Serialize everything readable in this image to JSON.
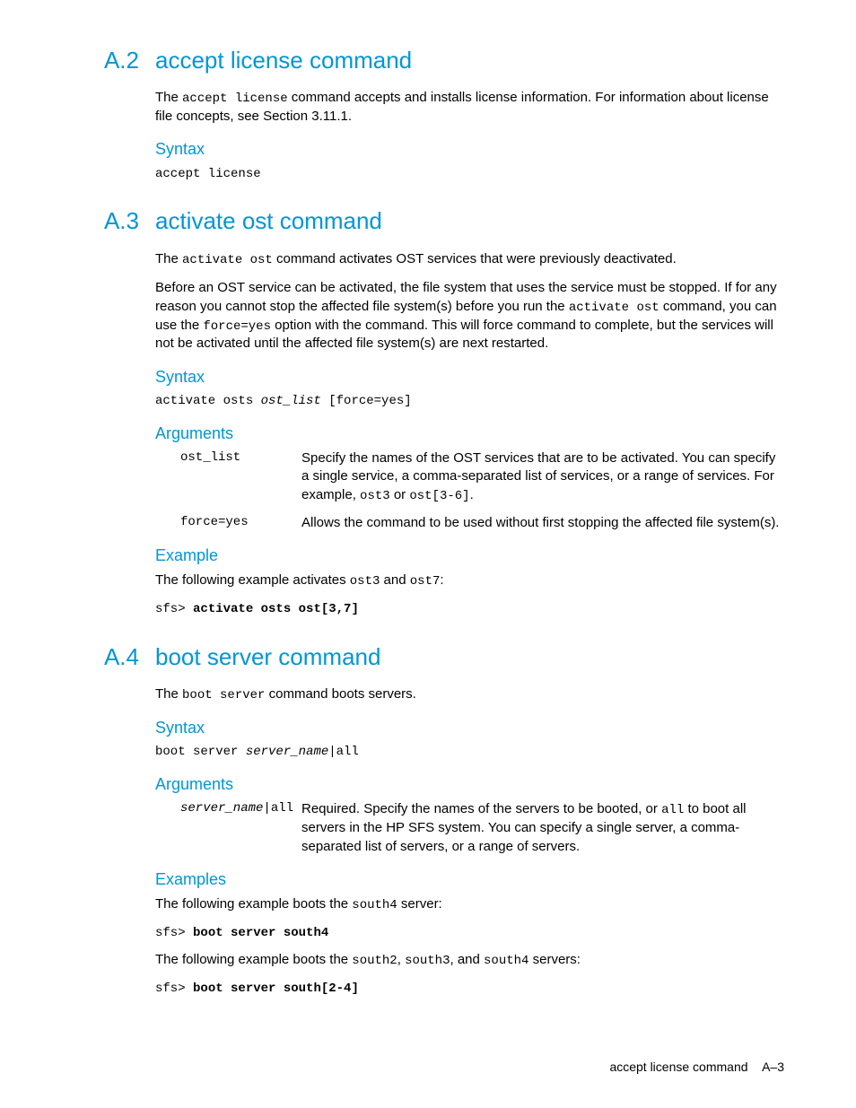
{
  "sections": [
    {
      "number": "A.2",
      "title": "accept license command",
      "intro_pre": "The ",
      "intro_code": "accept license",
      "intro_post": " command accepts and installs license information. For information about license file concepts, see Section 3.11.1.",
      "syntax_label": "Syntax",
      "syntax_code": "accept license"
    },
    {
      "number": "A.3",
      "title": "activate ost command",
      "intro_pre": "The ",
      "intro_code": "activate ost",
      "intro_post": " command activates OST services that were previously deactivated.",
      "para2_a": "Before an OST service can be activated, the file system that uses the service must be stopped. If for any reason you cannot stop the affected file system(s) before you run the ",
      "para2_code1": "activate ost",
      "para2_b": " command, you can use the ",
      "para2_code2": "force=yes",
      "para2_c": " option with the command. This will force command to complete, but the services will not be activated until the affected file system(s) are next restarted.",
      "syntax_label": "Syntax",
      "syntax_line_a": "activate osts ",
      "syntax_line_italic": "ost_list",
      "syntax_line_b": " [force=yes]",
      "arguments_label": "Arguments",
      "arg1_name": "ost_list",
      "arg1_desc_a": "Specify the names of the OST services that are to be activated. You can specify a single service, a comma-separated list of services, or a range of services. For example, ",
      "arg1_desc_code1": "ost3",
      "arg1_desc_b": " or ",
      "arg1_desc_code2": "ost[3-6]",
      "arg1_desc_c": ".",
      "arg2_name": "force=yes",
      "arg2_desc": "Allows the command to be used without first stopping the affected file system(s).",
      "example_label": "Example",
      "example_intro_a": "The following example activates ",
      "example_intro_code1": "ost3",
      "example_intro_b": " and ",
      "example_intro_code2": "ost7",
      "example_intro_c": ":",
      "example_prompt": "sfs> ",
      "example_cmd": "activate osts ost[3,7]"
    },
    {
      "number": "A.4",
      "title": "boot server command",
      "intro_pre": "The ",
      "intro_code": "boot server",
      "intro_post": " command boots servers.",
      "syntax_label": "Syntax",
      "syntax_line_a": "boot server ",
      "syntax_line_italic": "server_name",
      "syntax_line_b": "|all",
      "arguments_label": "Arguments",
      "arg1_name_italic": "server_name",
      "arg1_name_plain": "|all",
      "arg1_desc_a": "Required. Specify the names of the servers to be booted, or ",
      "arg1_desc_code1": "all",
      "arg1_desc_b": " to boot all servers in the HP SFS system. You can specify a single server, a comma-separated list of servers, or a range of servers.",
      "examples_label": "Examples",
      "ex1_intro_a": "The following example boots the ",
      "ex1_intro_code": "south4",
      "ex1_intro_b": " server:",
      "ex1_prompt": "sfs> ",
      "ex1_cmd": "boot server south4",
      "ex2_intro_a": "The following example boots the ",
      "ex2_intro_code1": "south2",
      "ex2_intro_b": ", ",
      "ex2_intro_code2": "south3",
      "ex2_intro_c": ", and ",
      "ex2_intro_code3": "south4",
      "ex2_intro_d": " servers:",
      "ex2_prompt": "sfs> ",
      "ex2_cmd": "boot server south[2-4]"
    }
  ],
  "footer_text": "accept license command",
  "footer_page": "A–3"
}
